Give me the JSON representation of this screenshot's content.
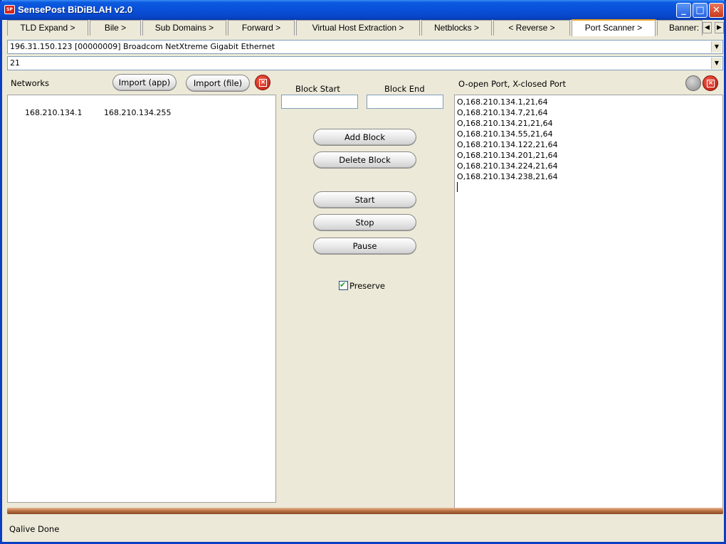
{
  "window": {
    "title": "SensePost BiDiBLAH v2.0",
    "icon_text": "SP",
    "controls": {
      "minimize": "_",
      "maximize": "□",
      "close": "✕"
    }
  },
  "tabs": [
    {
      "label": "TLD Expand >"
    },
    {
      "label": "Bile >"
    },
    {
      "label": "Sub Domains >"
    },
    {
      "label": "Forward >"
    },
    {
      "label": "Virtual Host Extraction >"
    },
    {
      "label": "Netblocks >"
    },
    {
      "label": "< Reverse >"
    },
    {
      "label": "Port Scanner >",
      "active": true
    },
    {
      "label": "Banner:"
    }
  ],
  "tab_scroll": {
    "left": "◀",
    "right": "▶"
  },
  "interface_select": {
    "value": "196.31.150.123  [00000009] Broadcom NetXtreme Gigabit Ethernet"
  },
  "port_select": {
    "value": "21"
  },
  "networks_panel": {
    "label": "Networks",
    "import_app": "Import (app)",
    "import_file": "Import (file)",
    "rows": [
      {
        "start": "168.210.134.1",
        "end": "168.210.134.255"
      }
    ]
  },
  "controls_panel": {
    "block_start_label": "Block Start",
    "block_end_label": "Block End",
    "block_start_value": "",
    "block_end_value": "",
    "add_block": "Add Block",
    "delete_block": "Delete Block",
    "start": "Start",
    "stop": "Stop",
    "pause": "Pause",
    "preserve_label": "Preserve",
    "preserve_checked": true
  },
  "results_panel": {
    "label": "O-open Port, X-closed Port",
    "lines": [
      "O,168.210.134.1,21,64",
      "O,168.210.134.7,21,64",
      "O,168.210.134.21,21,64",
      "O,168.210.134.55,21,64",
      "O,168.210.134.122,21,64",
      "O,168.210.134.201,21,64",
      "O,168.210.134.224,21,64",
      "O,168.210.134.238,21,64"
    ]
  },
  "status": {
    "text": "Qalive Done"
  }
}
